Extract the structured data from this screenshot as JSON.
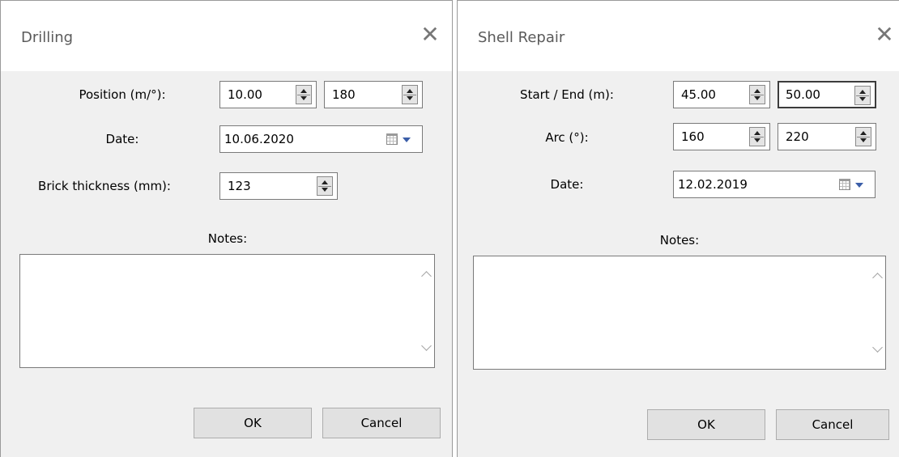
{
  "drilling": {
    "title": "Drilling",
    "close_glyph": "✕",
    "position_label": "Position (m/°):",
    "position_m": "10.00",
    "position_deg": "180",
    "date_label": "Date:",
    "date": "10.06.2020",
    "brick_label": "Brick thickness (mm):",
    "brick_thickness": "123",
    "notes_label": "Notes:",
    "notes_value": "",
    "ok_label": "OK",
    "cancel_label": "Cancel"
  },
  "shell_repair": {
    "title": "Shell Repair",
    "close_glyph": "✕",
    "startend_label": "Start / End (m):",
    "start": "45.00",
    "end": "50.00",
    "arc_label": "Arc (°):",
    "arc_start": "160",
    "arc_end": "220",
    "date_label": "Date:",
    "date": "12.02.2019",
    "notes_label": "Notes:",
    "notes_value": "",
    "ok_label": "OK",
    "cancel_label": "Cancel"
  },
  "icons": {
    "close": "close-icon",
    "spin": "spin-arrows-icon",
    "calendar": "calendar-icon",
    "dropdown": "chevron-down-icon"
  },
  "colors": {
    "dialog_bg": "#f0f0f0",
    "titlebar_bg": "#ffffff",
    "button_bg": "#e1e1e1",
    "dropdown_arrow": "#3b5ea8"
  }
}
